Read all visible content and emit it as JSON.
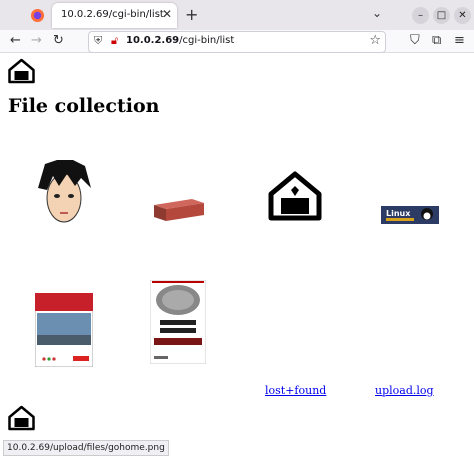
{
  "browser": {
    "tab_title": "10.0.2.69/cgi-bin/list",
    "tab_close": "✕",
    "new_tab": "+",
    "list_tabs": "⌄",
    "minimize": "–",
    "maximize": "□",
    "close": "✕",
    "back": "←",
    "forward": "→",
    "reload": "↻",
    "url_host": "10.0.2.69",
    "url_path": "/cgi-bin/list",
    "bookmark": "☆",
    "pocket": "⛉",
    "extensions": "⧉",
    "menu": "≡"
  },
  "page": {
    "heading": "File collection",
    "links": [
      "lost+found",
      "upload.log"
    ]
  },
  "status_bar": {
    "url": "10.0.2.69/upload/files/gohome.png"
  },
  "icons": [
    "firefox-icon",
    "home-icon",
    "anime-face-icon",
    "brick-icon",
    "linux-banner-icon",
    "book-cover-icon",
    "linux-kernel-book-icon"
  ]
}
